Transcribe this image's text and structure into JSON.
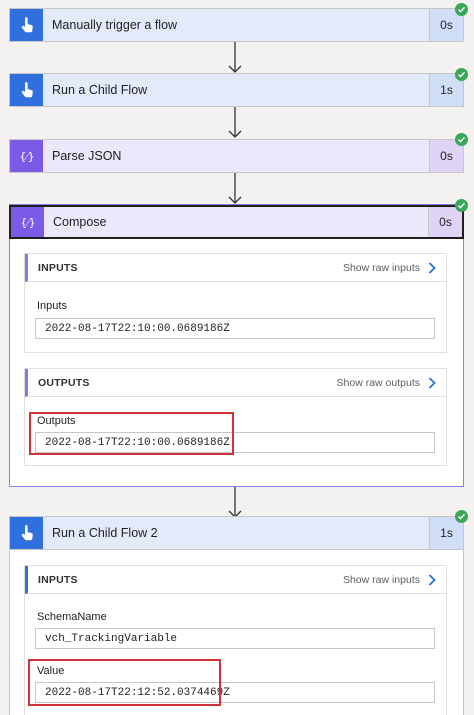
{
  "steps": [
    {
      "title": "Manually trigger a flow",
      "duration": "0s"
    },
    {
      "title": "Run a Child Flow",
      "duration": "1s"
    },
    {
      "title": "Parse JSON",
      "duration": "0s"
    },
    {
      "title": "Compose",
      "duration": "0s"
    },
    {
      "title": "Run a Child Flow 2",
      "duration": "1s"
    }
  ],
  "compose": {
    "inputs_header": "INPUTS",
    "show_raw_inputs": "Show raw inputs",
    "inputs_label": "Inputs",
    "inputs_value": "2022-08-17T22:10:00.0689186Z",
    "outputs_header": "OUTPUTS",
    "show_raw_outputs": "Show raw outputs",
    "outputs_label": "Outputs",
    "outputs_value": "2022-08-17T22:10:00.0689186Z"
  },
  "child2": {
    "inputs_header": "INPUTS",
    "show_raw_inputs": "Show raw inputs",
    "schema_label": "SchemaName",
    "schema_value": "vch_TrackingVariable",
    "value_label": "Value",
    "value_value": "2022-08-17T22:12:52.0374469Z"
  },
  "colors": {
    "trigger_blue": "#2f6fde",
    "data_purple": "#7a5ae6",
    "success_green": "#3aa757",
    "highlight_red": "#d13438"
  },
  "icons": [
    "hand-pointer-icon",
    "braces-icon",
    "check-circle-icon",
    "chevron-right-icon",
    "arrow-down-icon"
  ]
}
